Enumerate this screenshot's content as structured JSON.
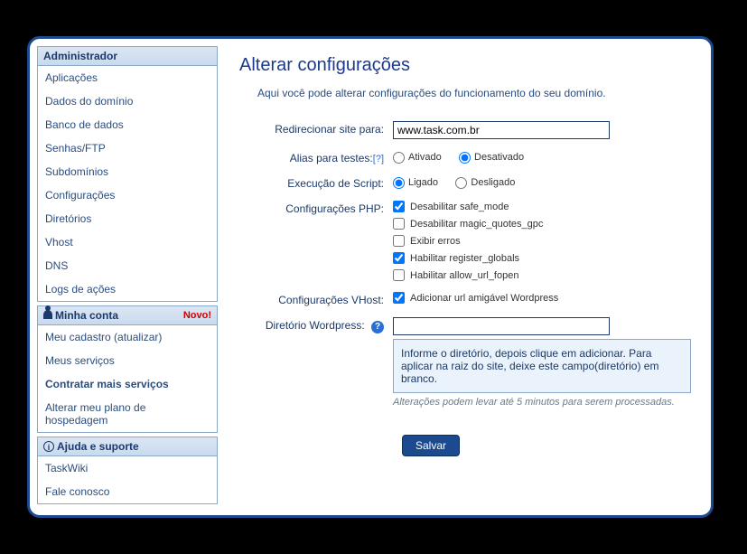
{
  "sidebar": {
    "admin": {
      "title": "Administrador",
      "items": [
        "Aplicações",
        "Dados do domínio",
        "Banco de dados",
        "Senhas/FTP",
        "Subdomínios",
        "Configurações",
        "Diretórios",
        "Vhost",
        "DNS",
        "Logs de ações"
      ]
    },
    "account": {
      "title": "Minha conta",
      "badge": "Novo!",
      "items": [
        "Meu cadastro (atualizar)",
        "Meus serviços",
        "Contratar mais serviços",
        "Alterar meu plano de hospedagem"
      ],
      "bold_index": 2
    },
    "help": {
      "title": "Ajuda e suporte",
      "items": [
        "TaskWiki",
        "Fale conosco"
      ]
    }
  },
  "main": {
    "heading": "Alterar configurações",
    "description": "Aqui você pode alterar configurações do funcionamento do seu domínio."
  },
  "form": {
    "redirect": {
      "label": "Redirecionar site para:",
      "value": "www.task.com.br"
    },
    "alias": {
      "label": "Alias para testes:",
      "help": "[?]",
      "opt_on": "Ativado",
      "opt_off": "Desativado",
      "selected": "off"
    },
    "script": {
      "label": "Execução de Script:",
      "opt_on": "Ligado",
      "opt_off": "Desligado",
      "selected": "on"
    },
    "php": {
      "label": "Configurações PHP:",
      "options": [
        {
          "label": "Desabilitar safe_mode",
          "checked": true
        },
        {
          "label": "Desabilitar magic_quotes_gpc",
          "checked": false
        },
        {
          "label": "Exibir erros",
          "checked": false
        },
        {
          "label": "Habilitar register_globals",
          "checked": true
        },
        {
          "label": "Habilitar allow_url_fopen",
          "checked": false
        }
      ]
    },
    "vhost": {
      "label": "Configurações VHost:",
      "option": "Adicionar url amigável Wordpress",
      "checked": true
    },
    "wpdir": {
      "label": "Diretório Wordpress:",
      "value": ""
    },
    "info_box": "Informe o diretório, depois clique em adicionar. Para aplicar na raiz do site, deixe este campo(diretório) em branco.",
    "note": "Alterações podem levar até 5 minutos para serem processadas.",
    "save": "Salvar"
  }
}
